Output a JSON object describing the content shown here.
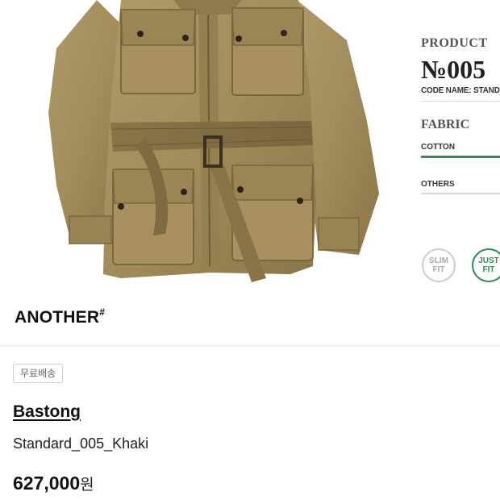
{
  "spec": {
    "product_label": "PRODUCT",
    "number": "№005",
    "code_name": "CODE NAME: STANDA",
    "fabric_label": "FABRIC",
    "cotton_label": "COTTON",
    "others_label": "OTHERS",
    "slim_fit": "SLIM\nFIT",
    "just_fit": "JUST\nFIT",
    "colors": {
      "accent": "#2e8b57",
      "inactive": "#cccccc"
    }
  },
  "brand": {
    "name": "ANOTHER",
    "mark": "#"
  },
  "badge": {
    "label": "무료배송"
  },
  "product": {
    "name": "Bastong",
    "subtitle": "Standard_005_Khaki",
    "price": "627,000",
    "currency": "원"
  },
  "image": {
    "subject": "khaki belted field jacket",
    "color": "#9c8555"
  }
}
